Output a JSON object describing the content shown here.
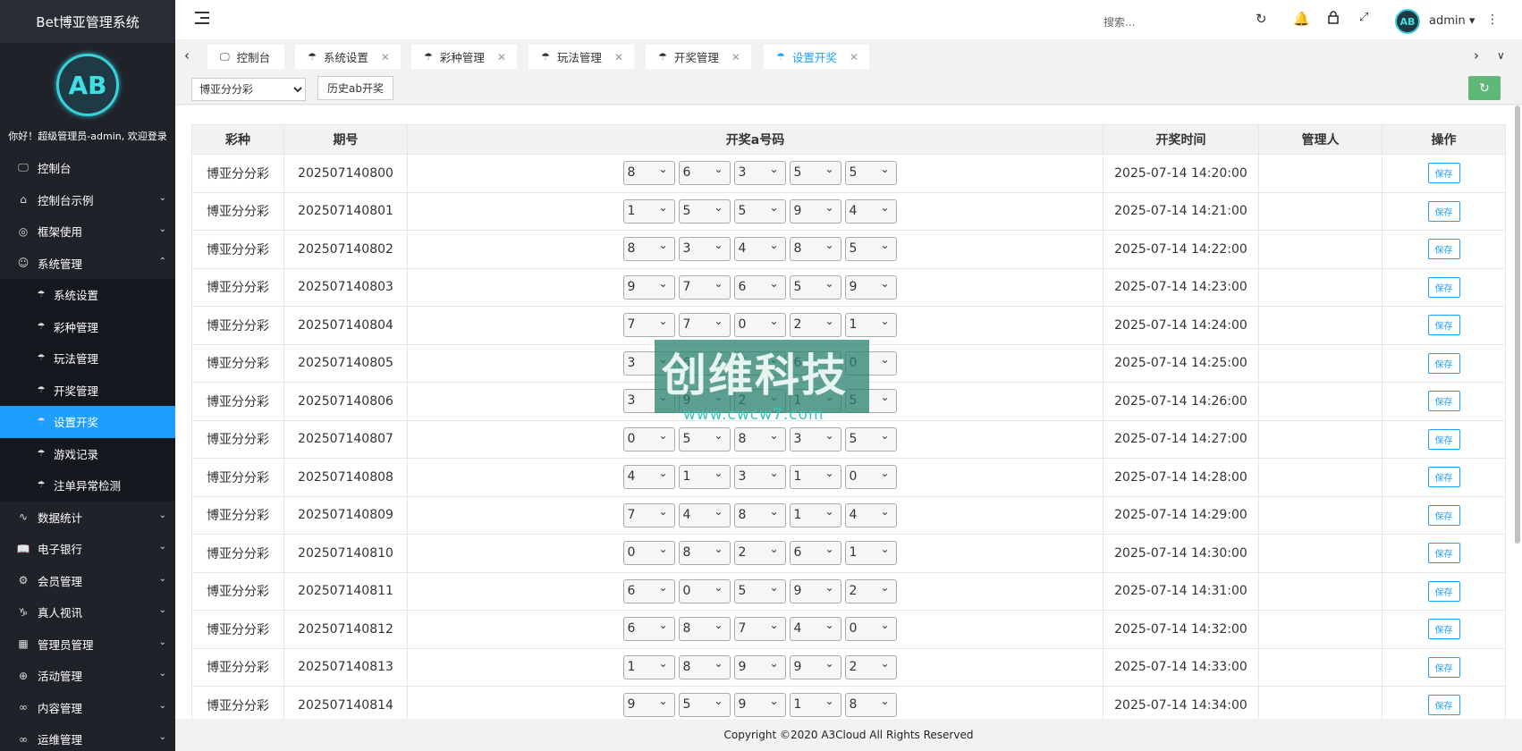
{
  "sidebar": {
    "brand": "Bet博亚管理系统",
    "logo_text": "AB",
    "welcome": "你好！超级管理员-admin, 欢迎登录",
    "items": [
      {
        "label": "控制台",
        "icon": "monitor-icon"
      },
      {
        "label": "控制台示例",
        "icon": "home-icon"
      },
      {
        "label": "框架使用",
        "icon": "circle-icon"
      },
      {
        "label": "系统管理",
        "icon": "user-icon"
      }
    ],
    "sub_items": [
      {
        "label": "系统设置"
      },
      {
        "label": "彩种管理"
      },
      {
        "label": "玩法管理"
      },
      {
        "label": "开奖管理"
      },
      {
        "label": "设置开奖"
      },
      {
        "label": "游戏记录"
      },
      {
        "label": "注单异常检测"
      }
    ],
    "items2": [
      {
        "label": "数据统计"
      },
      {
        "label": "电子银行"
      },
      {
        "label": "会员管理"
      },
      {
        "label": "真人视讯"
      },
      {
        "label": "管理员管理"
      },
      {
        "label": "活动管理"
      },
      {
        "label": "内容管理"
      },
      {
        "label": "运维管理"
      }
    ]
  },
  "header": {
    "search_placeholder": "搜索...",
    "username": "admin",
    "avatar_text": "AB"
  },
  "tabs": [
    {
      "label": "控制台"
    },
    {
      "label": "系统设置"
    },
    {
      "label": "彩种管理"
    },
    {
      "label": "玩法管理"
    },
    {
      "label": "开奖管理"
    },
    {
      "label": "设置开奖"
    }
  ],
  "toolbar": {
    "select_value": "博亚分分彩",
    "history_label": "历史ab开奖"
  },
  "table": {
    "headers": [
      "彩种",
      "期号",
      "开奖a号码",
      "开奖时间",
      "管理人",
      "操作"
    ],
    "save_label": "保存",
    "rows": [
      {
        "lot": "博亚分分彩",
        "issue": "202507140800",
        "nums": [
          "8",
          "6",
          "3",
          "5",
          "5"
        ],
        "time": "2025-07-14 14:20:00",
        "mgr": ""
      },
      {
        "lot": "博亚分分彩",
        "issue": "202507140801",
        "nums": [
          "1",
          "5",
          "5",
          "9",
          "4"
        ],
        "time": "2025-07-14 14:21:00",
        "mgr": ""
      },
      {
        "lot": "博亚分分彩",
        "issue": "202507140802",
        "nums": [
          "8",
          "3",
          "4",
          "8",
          "5"
        ],
        "time": "2025-07-14 14:22:00",
        "mgr": ""
      },
      {
        "lot": "博亚分分彩",
        "issue": "202507140803",
        "nums": [
          "9",
          "7",
          "6",
          "5",
          "9"
        ],
        "time": "2025-07-14 14:23:00",
        "mgr": ""
      },
      {
        "lot": "博亚分分彩",
        "issue": "202507140804",
        "nums": [
          "7",
          "7",
          "0",
          "2",
          "1"
        ],
        "time": "2025-07-14 14:24:00",
        "mgr": ""
      },
      {
        "lot": "博亚分分彩",
        "issue": "202507140805",
        "nums": [
          "3",
          "6",
          "7",
          "6",
          "0"
        ],
        "time": "2025-07-14 14:25:00",
        "mgr": ""
      },
      {
        "lot": "博亚分分彩",
        "issue": "202507140806",
        "nums": [
          "3",
          "9",
          "2",
          "1",
          "5"
        ],
        "time": "2025-07-14 14:26:00",
        "mgr": ""
      },
      {
        "lot": "博亚分分彩",
        "issue": "202507140807",
        "nums": [
          "0",
          "5",
          "8",
          "3",
          "5"
        ],
        "time": "2025-07-14 14:27:00",
        "mgr": ""
      },
      {
        "lot": "博亚分分彩",
        "issue": "202507140808",
        "nums": [
          "4",
          "1",
          "3",
          "1",
          "0"
        ],
        "time": "2025-07-14 14:28:00",
        "mgr": ""
      },
      {
        "lot": "博亚分分彩",
        "issue": "202507140809",
        "nums": [
          "7",
          "4",
          "8",
          "1",
          "4"
        ],
        "time": "2025-07-14 14:29:00",
        "mgr": ""
      },
      {
        "lot": "博亚分分彩",
        "issue": "202507140810",
        "nums": [
          "0",
          "8",
          "2",
          "6",
          "1"
        ],
        "time": "2025-07-14 14:30:00",
        "mgr": ""
      },
      {
        "lot": "博亚分分彩",
        "issue": "202507140811",
        "nums": [
          "6",
          "0",
          "5",
          "9",
          "2"
        ],
        "time": "2025-07-14 14:31:00",
        "mgr": ""
      },
      {
        "lot": "博亚分分彩",
        "issue": "202507140812",
        "nums": [
          "6",
          "8",
          "7",
          "4",
          "0"
        ],
        "time": "2025-07-14 14:32:00",
        "mgr": ""
      },
      {
        "lot": "博亚分分彩",
        "issue": "202507140813",
        "nums": [
          "1",
          "8",
          "9",
          "9",
          "2"
        ],
        "time": "2025-07-14 14:33:00",
        "mgr": ""
      },
      {
        "lot": "博亚分分彩",
        "issue": "202507140814",
        "nums": [
          "9",
          "5",
          "9",
          "1",
          "8"
        ],
        "time": "2025-07-14 14:34:00",
        "mgr": ""
      }
    ]
  },
  "watermark": {
    "text": "创维科技",
    "url": "www.cwcw7.com"
  },
  "footer": {
    "copyright": "Copyright ©2020 A3Cloud All Rights Reserved"
  }
}
